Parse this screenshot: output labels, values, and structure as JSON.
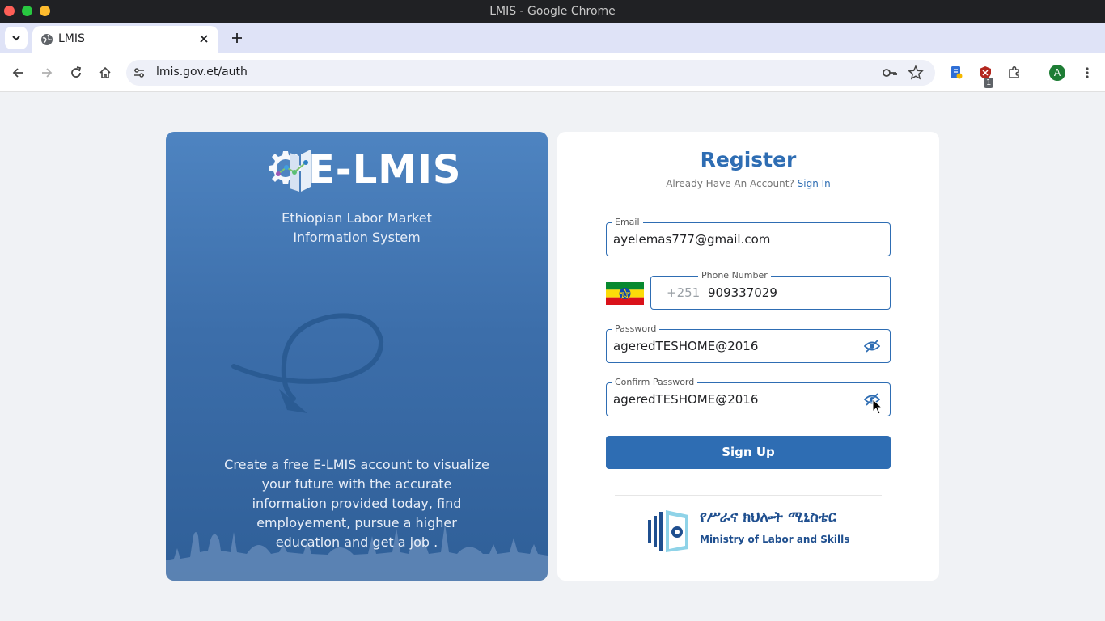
{
  "window": {
    "title": "LMIS - Google Chrome",
    "controls": {
      "close_color": "#ff5f57",
      "minimize_color": "#28c840",
      "maximize_color": "#febc2e"
    }
  },
  "tabs": [
    {
      "title": "LMIS",
      "active": true
    }
  ],
  "toolbar": {
    "url": "lmis.gov.et/auth",
    "extension_badge": "1",
    "profile_initial": "A"
  },
  "promo": {
    "logo_text": "E-LMIS",
    "subtitle_line1": "Ethiopian Labor Market",
    "subtitle_line2": "Information System",
    "description": "Create a free E-LMIS account to visualize your future with the accurate information provided today, find employement, pursue a higher education and get a job ."
  },
  "register": {
    "title": "Register",
    "signin_prompt": "Already Have An Account?",
    "signin_link": "Sign In",
    "email": {
      "label": "Email",
      "value": "ayelemas777@gmail.com"
    },
    "phone": {
      "label": "Phone Number",
      "prefix": "+251",
      "value": "909337029"
    },
    "password": {
      "label": "Password",
      "value": "ageredTESHOME@2016"
    },
    "confirm_password": {
      "label": "Confirm Password",
      "value": "ageredTESHOME@2016"
    },
    "submit_label": "Sign Up"
  },
  "ministry": {
    "name_amharic": "የሥራና ክህሎት ሚኒስቴር",
    "name_english": "Ministry of Labor and Skills"
  },
  "colors": {
    "brand_blue": "#2e6db3",
    "panel_gradient_top": "#4e84c1",
    "panel_gradient_bottom": "#2f5f98",
    "page_background": "#f0f2f5"
  }
}
